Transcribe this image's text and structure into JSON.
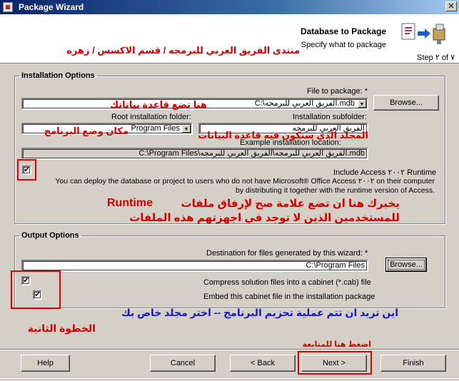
{
  "window": {
    "title": "Package Wizard",
    "close_glyph": "✕"
  },
  "header": {
    "title": "Database to Package",
    "subtitle": "Specify what to package",
    "step": "Step ٢ of ٧",
    "icon": "package-wizard-icon",
    "annotation": "منتدى الفريق العربي للبرمجه / قسم الاكسس / زهره"
  },
  "installation": {
    "legend": "Installation Options",
    "file_label": "File to package: *",
    "file_value": "C:\\الفريق العربي للبرمجه.mdb",
    "browse_label": "Browse...",
    "root_label": "Root installation folder:",
    "root_value": "Program Files",
    "subfolder_label": "Installation subfolder:",
    "subfolder_value": "الفريق العربي للبرمجه",
    "example_label": "Example installation location:",
    "example_value": "C:\\Program Files\\الفريق العربي للبرمجه\\الفريق العربي للبرمجه.mdb",
    "runtime_checked": true,
    "runtime_label": "Include Access ٢٠٠٢ Runtime",
    "runtime_desc_1": "You can deploy the database or project to users who do not have Microsoft® Office Access ٢٠٠٢ on their computer",
    "runtime_desc_2": "by distributing it together with the runtime version of Access."
  },
  "output": {
    "legend": "Output Options",
    "dest_label": "Destination for files generated by this wizard: *",
    "dest_value": "C:\\Program Files",
    "browse_label": "Browse...",
    "compress_checked": true,
    "compress_label": "Compress solution files into a cabinet (*.cab) file",
    "embed_checked": true,
    "embed_label": "Embed this cabinet file in the installation package"
  },
  "annotations": {
    "file": "هنا تضع قاعدة بياناتك",
    "root": "مكان وضع البرنامج",
    "subfolder": "المجلد الذي ستكون فيه قاعدة البيانات",
    "runtime_1": "يخبرك هنا ان تضع علامة صح لإرفاق ملفات",
    "runtime_word": "Runtime",
    "runtime_2": "للمستخدمين الذين لا توجد في اجهزتهم هذه الملفات",
    "step": "الخطوة الثانية",
    "cab": "اين تريد ان تتم عملية تحزيم البرنامج  --  اختر مجلد خاص بك",
    "next": "اضغط هنا للمتابعة"
  },
  "buttons": {
    "help": "Help",
    "cancel": "Cancel",
    "back": "< Back",
    "next": "Next >",
    "finish": "Finish"
  },
  "colors": {
    "annotation_red": "#d40000",
    "annotation_blue": "#1818c8",
    "highlight_box": "#e00000"
  }
}
